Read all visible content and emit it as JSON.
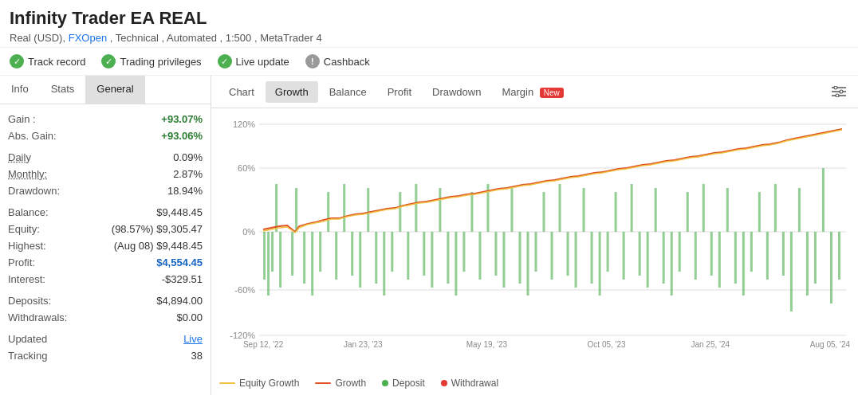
{
  "title": "Infinity Trader EA REAL",
  "subtitle": {
    "currency": "Real (USD),",
    "broker": "FXOpen",
    "details": ", Technical , Automated , 1:500 , MetaTrader 4"
  },
  "badges": [
    {
      "type": "check",
      "label": "Track record"
    },
    {
      "type": "check",
      "label": "Trading privileges"
    },
    {
      "type": "check",
      "label": "Live update"
    },
    {
      "type": "info",
      "label": "Cashback"
    }
  ],
  "left_tabs": [
    {
      "id": "info",
      "label": "Info"
    },
    {
      "id": "stats",
      "label": "Stats"
    },
    {
      "id": "general",
      "label": "General",
      "active": true
    }
  ],
  "stats": {
    "gain_label": "Gain :",
    "gain_value": "+93.07%",
    "abs_gain_label": "Abs. Gain:",
    "abs_gain_value": "+93.06%",
    "daily_label": "Daily",
    "daily_value": "0.09%",
    "monthly_label": "Monthly:",
    "monthly_value": "2.87%",
    "drawdown_label": "Drawdown:",
    "drawdown_value": "18.94%",
    "balance_label": "Balance:",
    "balance_value": "$9,448.45",
    "equity_label": "Equity:",
    "equity_value": "(98.57%) $9,305.47",
    "highest_label": "Highest:",
    "highest_value": "(Aug 08) $9,448.45",
    "profit_label": "Profit:",
    "profit_value": "$4,554.45",
    "interest_label": "Interest:",
    "interest_value": "-$329.51",
    "deposits_label": "Deposits:",
    "deposits_value": "$4,894.00",
    "withdrawals_label": "Withdrawals:",
    "withdrawals_value": "$0.00",
    "updated_label": "Updated",
    "updated_value": "Live",
    "tracking_label": "Tracking",
    "tracking_value": "38"
  },
  "chart_tabs": [
    {
      "id": "chart",
      "label": "Chart"
    },
    {
      "id": "growth",
      "label": "Growth",
      "active": true
    },
    {
      "id": "balance",
      "label": "Balance"
    },
    {
      "id": "profit",
      "label": "Profit"
    },
    {
      "id": "drawdown",
      "label": "Drawdown"
    },
    {
      "id": "margin",
      "label": "Margin",
      "new": true
    }
  ],
  "chart_yaxis": [
    "120%",
    "60%",
    "0%",
    "-60%",
    "-120%"
  ],
  "chart_xaxis": [
    "Sep 12, '22",
    "Jan 23, '23",
    "May 19, '23",
    "Oct 05, '23",
    "Jan 25, '24",
    "Aug 05, '24"
  ],
  "legend": [
    {
      "type": "line",
      "color": "#f0c040",
      "label": "Equity Growth"
    },
    {
      "type": "line",
      "color": "#e05020",
      "label": "Growth"
    },
    {
      "type": "dot",
      "color": "#4caf50",
      "label": "Deposit"
    },
    {
      "type": "dot",
      "color": "#e53935",
      "label": "Withdrawal"
    }
  ],
  "colors": {
    "green": "#2e7d32",
    "blue": "#1565c0",
    "red": "#e53935",
    "accent": "#4caf50"
  }
}
